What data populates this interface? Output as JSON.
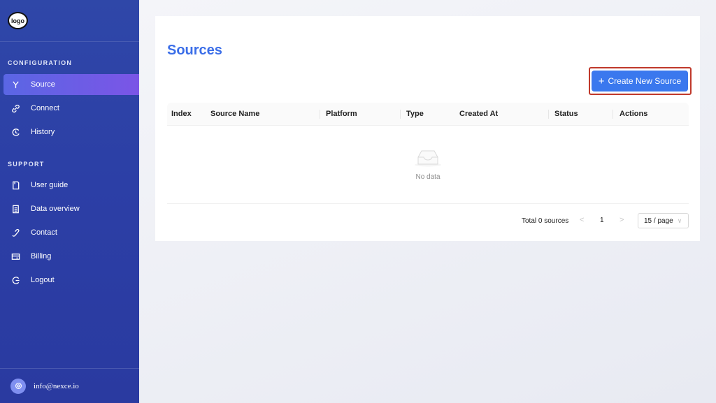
{
  "logo": {
    "text": "logo"
  },
  "sidebar": {
    "configuration_title": "CONFIGURATION",
    "support_title": "SUPPORT",
    "config_items": [
      {
        "label": "Source",
        "icon": "fork-icon",
        "active": true
      },
      {
        "label": "Connect",
        "icon": "link-icon",
        "active": false
      },
      {
        "label": "History",
        "icon": "clock-icon",
        "active": false
      }
    ],
    "support_items": [
      {
        "label": "User guide",
        "icon": "document-icon"
      },
      {
        "label": "Data overview",
        "icon": "list-icon"
      },
      {
        "label": "Contact",
        "icon": "phone-icon"
      },
      {
        "label": "Billing",
        "icon": "card-icon"
      },
      {
        "label": "Logout",
        "icon": "logout-icon"
      }
    ],
    "user_email": "info@nexce.io"
  },
  "main": {
    "title": "Sources",
    "create_button_label": "Create New Source",
    "table": {
      "columns": [
        "Index",
        "Source Name",
        "Platform",
        "Type",
        "Created At",
        "Status",
        "Actions"
      ],
      "rows": [],
      "empty_text": "No data"
    },
    "pagination": {
      "total_text": "Total 0 sources",
      "prev": "<",
      "current_page": "1",
      "next": ">",
      "page_size": "15 / page"
    }
  },
  "colors": {
    "sidebar_bg": "#2c3fa6",
    "active_item": "#6a5ce6",
    "accent": "#3a78ee",
    "title": "#3b6ee8",
    "highlight_outline": "#c0392b"
  }
}
